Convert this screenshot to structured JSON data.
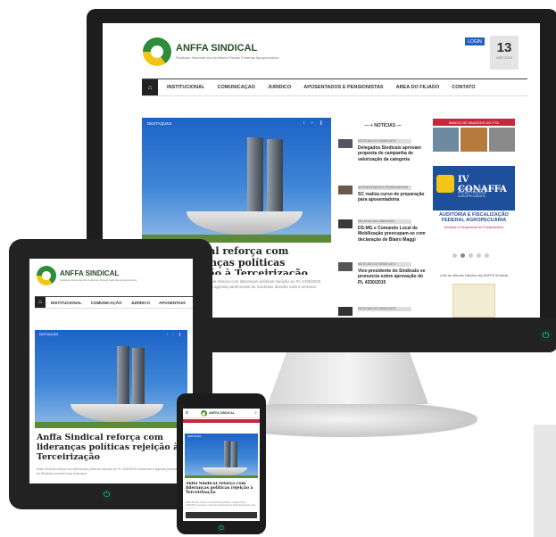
{
  "site": {
    "name": "ANFFA SINDICAL",
    "tagline": "Sindicato Nacional dos Auditores Fiscais Federais Agropecuários"
  },
  "header": {
    "login_label": "LOGIN",
    "date_day": "13",
    "date_month": "ABR 2015"
  },
  "nav": {
    "items": [
      "INSTITUCIONAL",
      "COMUNICAÇÃO",
      "JURÍDICO",
      "APOSENTADOS E PENSIONISTAS",
      "ÁREA DO FILIADO",
      "CONTATO"
    ]
  },
  "featured": {
    "section_label": "DESTAQUES",
    "headline": "Anffa Sindical reforça com lideranças políticas rejeição à Terceirização",
    "excerpt": "Anffa Sindical reforça com lideranças políticas rejeição ao PL 4330/2015 mantendo a agenda parlamentar do Sindicato durante toda a semana"
  },
  "news": {
    "heading": "+ NOTÍCIAS",
    "items": [
      {
        "tag": "NOTÍCIAS DO SINDICATO",
        "title": "Delegados Sindicais aprovam proposta de campanha de valorização da categoria"
      },
      {
        "tag": "APOSENTADOS E PENSIONISTAS",
        "title": "SC realiza curso de preparação para aposentadoria"
      },
      {
        "tag": "DELEGACIAS SINDICAIS",
        "title": "DS-MG e Comando Local de Mobilização preocupam-se com declaração de Blairo Maggi"
      },
      {
        "tag": "NOTÍCIAS DO SINDICATO",
        "title": "Vice-presidente do Sindicato se pronuncia sobre aprovação do PL 4330/2015"
      },
      {
        "tag": "NOTÍCIAS DO SINDICATO",
        "title": ""
      }
    ]
  },
  "sidebar": {
    "gallery_label": "BANCO DE IMAGENS DO FTA",
    "banner_title": "IV CONAFFA",
    "banner_sub": "CONGRESSO NACIONAL DOS FISCAIS FEDERAIS AGROPECUÁRIOS",
    "banner_theme": "AUDITORIA E FISCALIZAÇÃO FEDERAL AGROPECUÁRIA",
    "banner_theme_sub": "Desafios e Perspectivas de Fortalecimento",
    "magazine_caption": "Leia as últimas edições da ANFFA Sindical"
  },
  "colors": {
    "brand_green": "#2e8b3a",
    "brand_yellow": "#f2c618",
    "accent_red": "#c5283d",
    "power_led": "#1ed3a0"
  }
}
